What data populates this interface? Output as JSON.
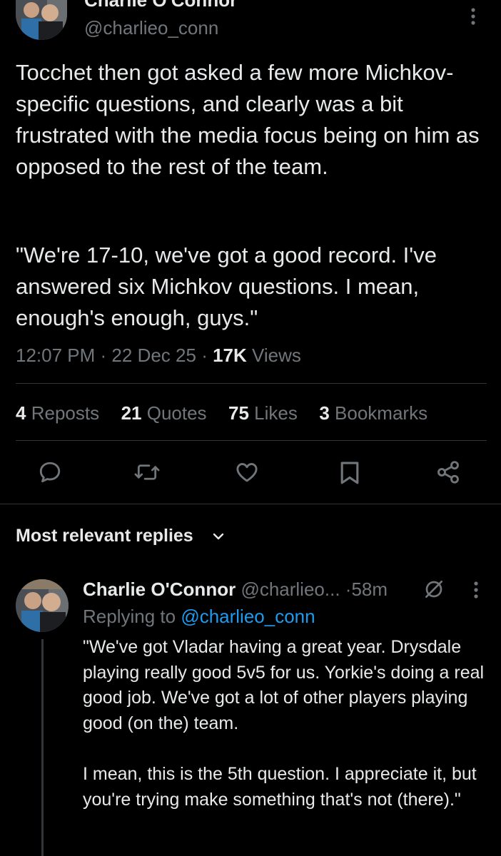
{
  "main_post": {
    "author_name": "Charlie O'Connor",
    "author_handle": "@charlieo_conn",
    "text_p1": "Tocchet then got asked a few more Michkov-specific questions, and clearly was a bit frustrated with the media focus being on him as opposed to the rest of the team.",
    "text_p2": "\"We're 17-10, we've got a good record. I've answered six Michkov questions. I mean, enough's enough, guys.\"",
    "time": "12:07 PM",
    "date": "22 Dec 25",
    "views_count": "17K",
    "views_label": "Views",
    "stats": {
      "reposts_count": "4",
      "reposts_label": "Reposts",
      "quotes_count": "21",
      "quotes_label": "Quotes",
      "likes_count": "75",
      "likes_label": "Likes",
      "bookmarks_count": "3",
      "bookmarks_label": "Bookmarks"
    },
    "action_icons": [
      "reply-icon",
      "repost-icon",
      "like-icon",
      "bookmark-icon",
      "share-icon"
    ]
  },
  "replies_header": {
    "label": "Most relevant replies"
  },
  "reply": {
    "author_name": "Charlie O'Connor",
    "author_handle": "@charlieo...",
    "dot": "·",
    "time_ago": "58m",
    "replying_prefix": "Replying to",
    "replying_handle": "@charlieo_conn",
    "text_p1": "\"We've got Vladar having a great year. Drysdale playing really good 5v5 for us. Yorkie's doing a real good job. We've got a lot of other players playing good (on the) team.",
    "text_p2": "I mean, this is the 5th question. I appreciate it, but you're trying make something that's not (there).\""
  },
  "colors": {
    "background": "#000000",
    "text": "#e7e9ea",
    "muted": "#71767b",
    "link": "#1d9bf0",
    "divider": "#2f3336"
  }
}
